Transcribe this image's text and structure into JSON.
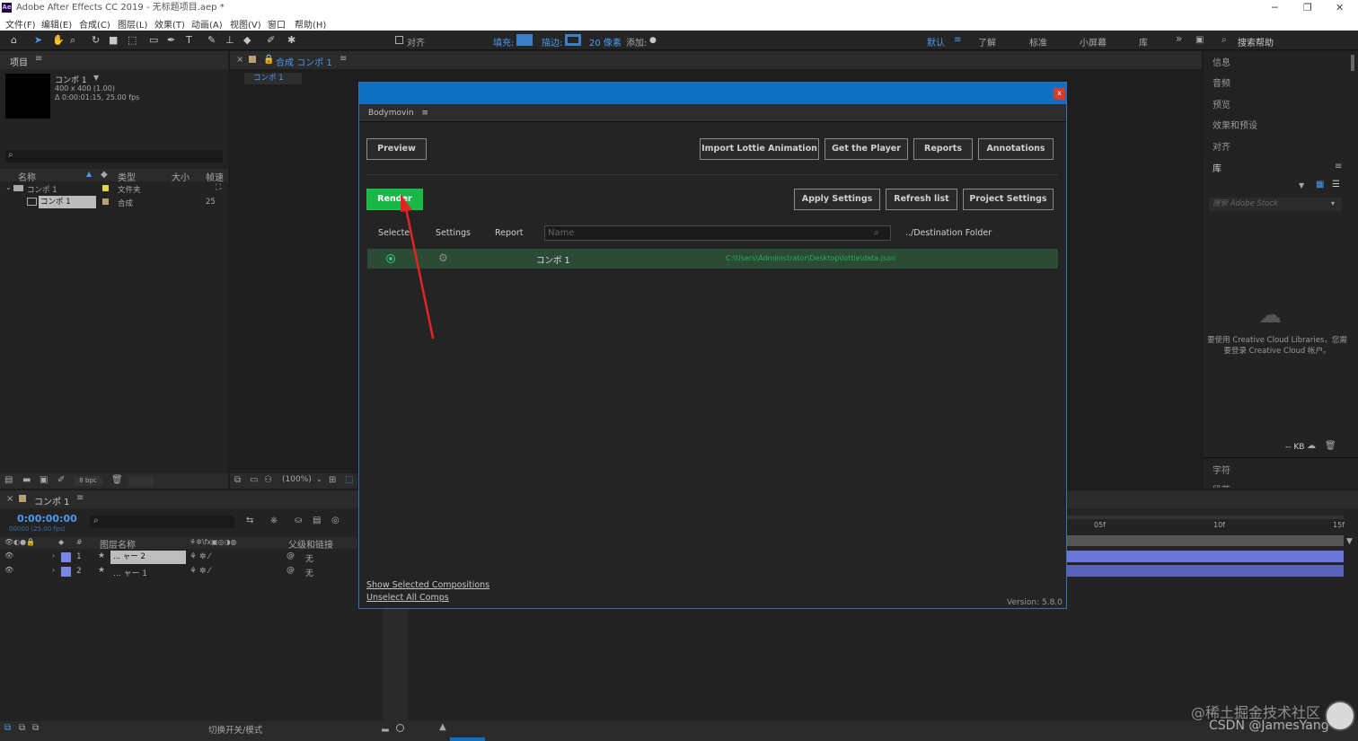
{
  "window": {
    "app_icon_text": "Ae",
    "title": "Adobe After Effects CC 2019 - 无标题项目.aep *"
  },
  "menu": [
    "文件(F)",
    "编辑(E)",
    "合成(C)",
    "图层(L)",
    "效果(T)",
    "动画(A)",
    "视图(V)",
    "窗口",
    "帮助(H)"
  ],
  "toolbar": {
    "align_label": "对齐",
    "fill_label": "填充:",
    "stroke_label": "描边:",
    "stroke_size": "20 像素",
    "add_label": "添加:",
    "workspaces": [
      "默认",
      "了解",
      "标准",
      "小屏幕",
      "库"
    ],
    "search_help": "搜索帮助"
  },
  "project": {
    "panel_title": "项目",
    "comp_name": "コンポ 1",
    "comp_info1": "400 x 400 (1.00)",
    "comp_info2": "Δ 0:00:01:15, 25.00 fps",
    "columns": [
      "名称",
      "类型",
      "大小",
      "帧速"
    ],
    "rows": [
      {
        "name": "コンポ 1",
        "type": "文件夹",
        "rate": ""
      },
      {
        "name": "コンポ 1",
        "type": "合成",
        "rate": "25"
      }
    ],
    "bpc": "8 bpc"
  },
  "composition": {
    "tab_label": "合成 コンポ 1",
    "subtab": "コンポ 1",
    "zoom": "(100%)"
  },
  "timeline": {
    "tab_label": "コンポ 1",
    "timecode": "0:00:00:00",
    "timecode_sub": "00000 (25.00 fps)",
    "columns": [
      "图层名称",
      "父级和链接"
    ],
    "layers": [
      {
        "num": "1",
        "name": "... ャー 2",
        "parent": "无"
      },
      {
        "num": "2",
        "name": "... ャー 1",
        "parent": "无"
      }
    ],
    "ruler": [
      "05f",
      "10f",
      "15f"
    ],
    "bottom_label": "切换开关/模式"
  },
  "right_panel": {
    "items": [
      "信息",
      "音频",
      "预览",
      "效果和预设",
      "对齐",
      "库"
    ],
    "stock_placeholder": "搜索 Adobe Stock",
    "cc_message": "要使用 Creative Cloud Libraries，您需要登录 Creative Cloud 帐户。",
    "kb": "-- KB",
    "bottom_items": [
      "字符",
      "段落"
    ]
  },
  "bodymovin": {
    "panel_title": "Bodymovin",
    "close": "x",
    "buttons": {
      "preview": "Preview",
      "import": "Import Lottie Animation",
      "player": "Get the Player",
      "reports": "Reports",
      "annotations": "Annotations",
      "render": "Render",
      "apply": "Apply Settings",
      "refresh": "Refresh list",
      "project": "Project Settings"
    },
    "columns": {
      "selected": "Selected",
      "settings": "Settings",
      "report": "Report",
      "destination": "../Destination Folder"
    },
    "search_placeholder": "Name",
    "comps": [
      {
        "name": "コンポ 1",
        "path": "C:\\Users\\Administrator\\Desktop\\lottie\\data.json",
        "selected": true
      }
    ],
    "links": {
      "show_selected": "Show Selected Compositions",
      "unselect": "Unselect All Comps"
    },
    "version": "Version: 5.8.0"
  },
  "watermark": {
    "line1": "@稀土掘金技术社区",
    "line2": "CSDN @JamesYang"
  },
  "colors": {
    "accent_blue": "#0d70c2",
    "render_green": "#19b748",
    "path_green": "#23b24c"
  }
}
